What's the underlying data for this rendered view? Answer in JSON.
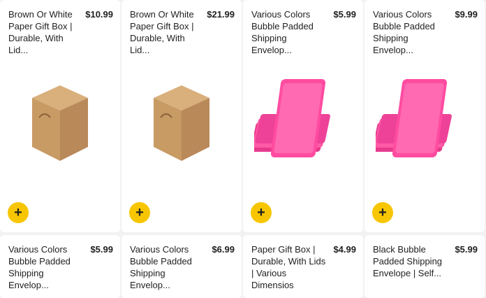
{
  "products_top": [
    {
      "title": "Brown Or White Paper Gift Box | Durable, With Lid...",
      "price": "$10.99",
      "image": "kraft-box"
    },
    {
      "title": "Brown Or White Paper Gift Box | Durable, With Lid...",
      "price": "$21.99",
      "image": "kraft-box"
    },
    {
      "title": "Various Colors Bubble Padded Shipping Envelop...",
      "price": "$5.99",
      "image": "pink-mailers"
    },
    {
      "title": "Various Colors Bubble Padded Shipping Envelop...",
      "price": "$9.99",
      "image": "pink-mailers"
    }
  ],
  "products_bottom": [
    {
      "title": "Various Colors Bubble Padded Shipping Envelop...",
      "price": "$5.99"
    },
    {
      "title": "Various Colors Bubble Padded Shipping Envelop...",
      "price": "$6.99"
    },
    {
      "title": "Paper Gift Box | Durable, With Lids | Various Dimensios",
      "price": "$4.99"
    },
    {
      "title": "Black Bubble Padded Shipping Envelope | Self...",
      "price": "$5.99"
    }
  ],
  "add_button": {
    "icon": "plus-icon",
    "label": "+",
    "color": "#f7c600"
  }
}
